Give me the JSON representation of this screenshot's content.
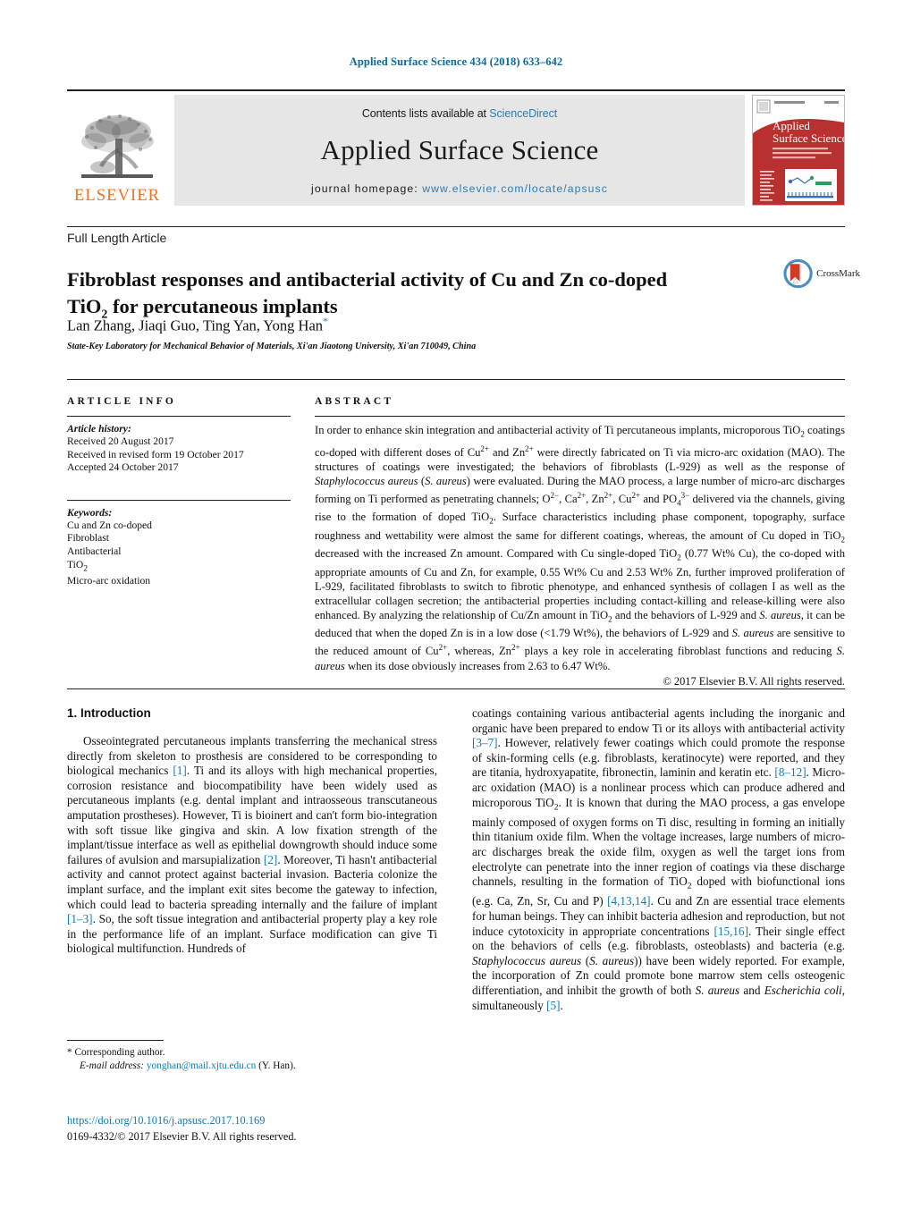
{
  "running_head": "Applied Surface Science 434 (2018) 633–642",
  "masthead": {
    "contents_prefix": "Contents lists available at ",
    "contents_link": "ScienceDirect",
    "journal_name": "Applied Surface Science",
    "homepage_prefix": "journal homepage: ",
    "homepage_link": "www.elsevier.com/locate/apsusc",
    "publisher": "ELSEVIER",
    "cover_title_line1": "Applied",
    "cover_title_line2": "Surface Science"
  },
  "article": {
    "type": "Full Length Article",
    "title_part1": "Fibroblast responses and antibacterial activity of Cu and Zn co-doped",
    "title_part2_pre": "TiO",
    "title_part2_sub": "2",
    "title_part2_post": " for percutaneous implants",
    "authors": "Lan Zhang, Jiaqi Guo, Ting Yan, Yong Han",
    "corresponding_marker": "*",
    "affiliation": "State-Key Laboratory for Mechanical Behavior of Materials, Xi'an Jiaotong University, Xi'an 710049, China",
    "crossmark_label": "CrossMark"
  },
  "article_info": {
    "heading": "ARTICLE INFO",
    "history_label": "Article history:",
    "history": [
      "Received 20 August 2017",
      "Received in revised form 19 October 2017",
      "Accepted 24 October 2017"
    ],
    "keywords_label": "Keywords:",
    "keywords_plain": [
      "Cu and Zn co-doped",
      "Fibroblast",
      "Antibacterial"
    ],
    "keyword_tio2_pre": "TiO",
    "keyword_tio2_sub": "2",
    "keyword_last": "Micro-arc oxidation"
  },
  "abstract": {
    "heading": "ABSTRACT",
    "copyright": "© 2017 Elsevier B.V. All rights reserved."
  },
  "introduction": {
    "heading": "1. Introduction"
  },
  "footnote": {
    "corresponding": "* Corresponding author.",
    "email_label": "E-mail address:",
    "email": "yonghan@mail.xjtu.edu.cn",
    "email_suffix": " (Y. Han)."
  },
  "footer": {
    "doi": "https://doi.org/10.1016/j.apsusc.2017.10.169",
    "issn": "0169-4332/© 2017 Elsevier B.V. All rights reserved."
  },
  "colors": {
    "link": "#0b7cb5",
    "running_head": "#0b6a9a",
    "elsevier_orange": "#f37021",
    "cover_red": "#b8312f",
    "band_gray": "#e6e6e6"
  }
}
